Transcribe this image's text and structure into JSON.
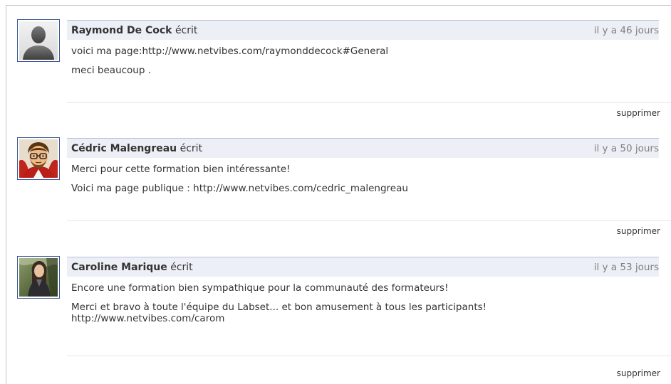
{
  "posts": [
    {
      "author": "Raymond De Cock",
      "verb": "écrit",
      "time": "il y a 46 jours",
      "avatar_icon": "default-user-silhouette-icon",
      "lines": [
        "voici ma page:http://www.netvibes.com/raymonddecock#General",
        "meci beaucoup ."
      ],
      "delete_label": "supprimer"
    },
    {
      "author": "Cédric Malengreau",
      "verb": "écrit",
      "time": "il y a 50 jours",
      "avatar_icon": "cartoon-avatar-icon",
      "lines": [
        "Merci pour cette formation bien intéressante!",
        "Voici ma page publique : http://www.netvibes.com/cedric_malengreau"
      ],
      "delete_label": "supprimer"
    },
    {
      "author": "Caroline Marique",
      "verb": "écrit",
      "time": "il y a 53 jours",
      "avatar_icon": "photo-avatar-icon",
      "lines": [
        "Encore une formation bien sympathique pour la communauté des formateurs!",
        "Merci et bravo à toute l'équipe du Labset... et bon amusement à tous les participants!",
        "http://www.netvibes.com/carom"
      ],
      "delete_label": "supprimer"
    }
  ],
  "colors": {
    "header_bg": "#eceff5",
    "header_border": "#b6c2d8",
    "avatar_border": "#3b5998",
    "timestamp": "#808080",
    "text": "#333333"
  }
}
